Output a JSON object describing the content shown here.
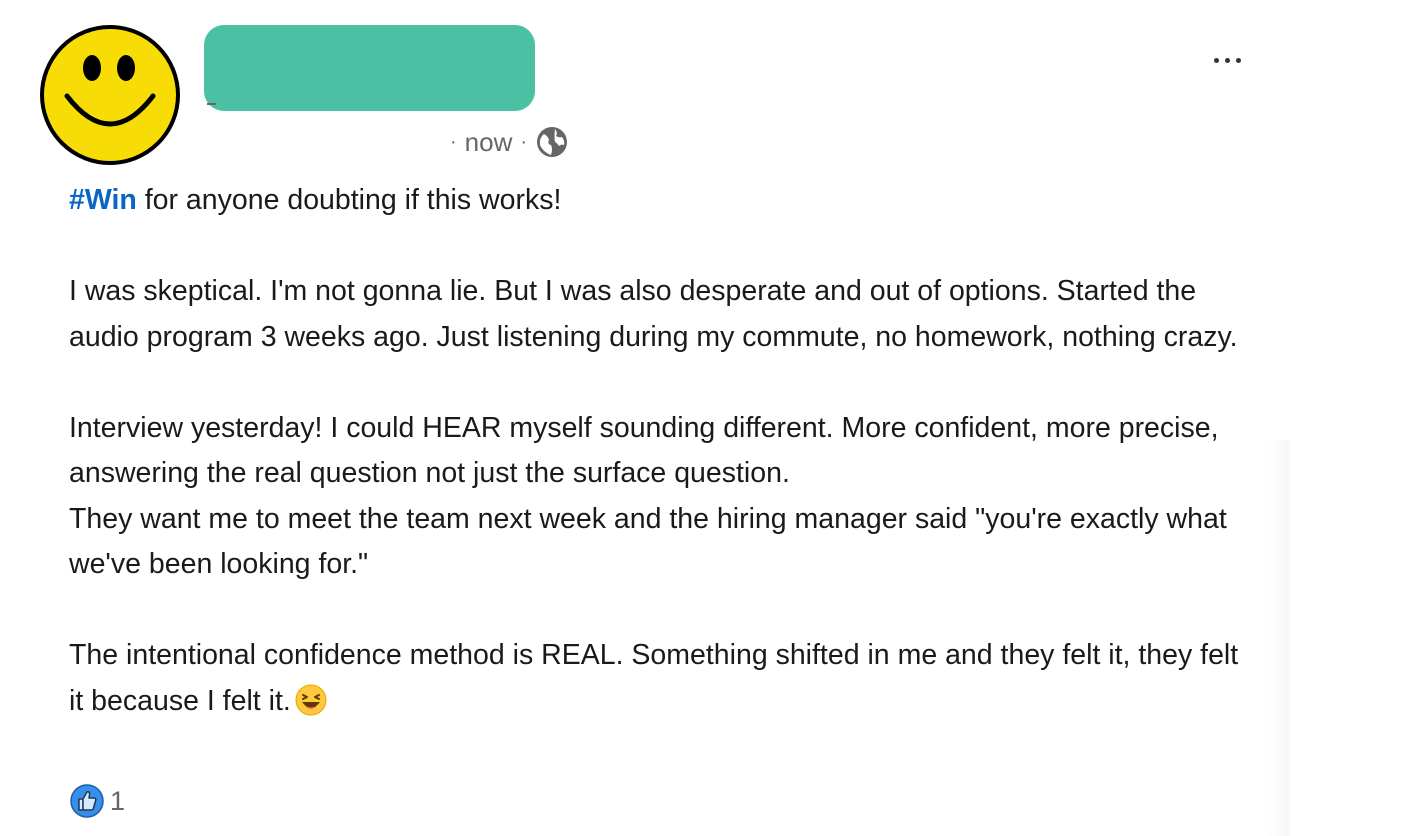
{
  "post": {
    "author": {
      "avatar_icon": "smiley-face-icon",
      "name_redacted_color": "#4cc0a3"
    },
    "meta": {
      "separator": "·",
      "time": "now",
      "visibility_icon": "globe-icon"
    },
    "more_icon": "ellipsis-icon",
    "body": {
      "hashtag": "#Win",
      "line1_rest": " for anyone doubting if this works!",
      "para2": "I was skeptical. I'm not gonna lie. But I was also desperate and out of options. Started the audio program 3 weeks ago. Just listening during my commute, no homework, nothing crazy.",
      "para3": "Interview yesterday! I could HEAR myself sounding different. More confident, more precise, answering the real question not just the surface question.",
      "para3b": "They want me to meet the team next week and the hiring manager said \"you're exactly what we've been looking for.\"",
      "para4": "The intentional confidence method is REAL. Something shifted in me and they felt it, they felt it because I felt it.",
      "emoji_icon": "laughing-face-emoji-icon"
    },
    "reactions": {
      "icon": "like-thumbs-up-icon",
      "count": "1"
    },
    "colors": {
      "hashtag": "#0a66c2",
      "meta_text": "#666666",
      "body_text": "#1a1a1a",
      "like_blue": "#378fe9"
    }
  }
}
